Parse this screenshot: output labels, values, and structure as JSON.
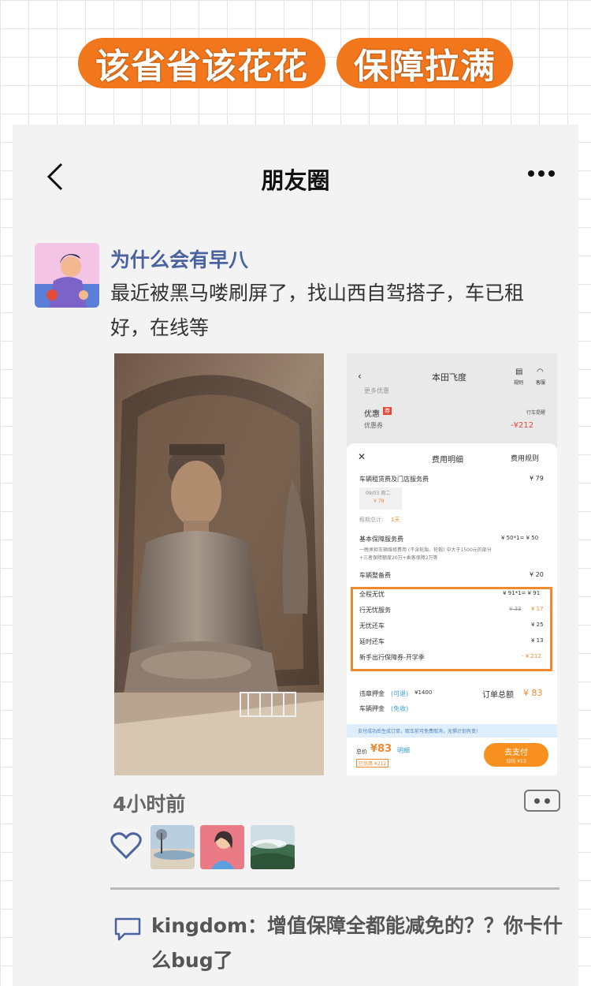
{
  "headline": {
    "left": "该省省该花花",
    "right": "保障拉满"
  },
  "nav": {
    "title": "朋友圈",
    "back_icon": "chevron-left-icon",
    "more_icon": "more-dots-icon"
  },
  "post": {
    "username": "为什么会有早八",
    "text": "最近被黑马喽刷屏了，找山西自驾搭子，车已租好，在线等",
    "time": "4小时前"
  },
  "receipt": {
    "car_name": "本田飞度",
    "rule_label": "规则",
    "service_label": "客服",
    "promo_label": "更多优惠",
    "discount_label": "优惠",
    "discount_tag": "券",
    "coupon_label": "优惠券",
    "coupon_value": "-¥212",
    "reminder_label": "行车提醒",
    "sheet_title": "费用明细",
    "sheet_rules": "费用规则",
    "rent_label": "车辆租赁费及门店服务费",
    "rent_value": "¥ 79",
    "date_chip": "09/03 周二",
    "date_price": "¥ 79",
    "total_days_label": "租期总计:",
    "total_days_value": "1天",
    "basic_label": "基本保障服务费",
    "basic_value": "¥ 50*1= ¥ 50",
    "basic_desc1": "一晚承担车辆维修费用 (不含轮胎、轮毂) 中大于1500元的部分",
    "basic_desc2": "+三者保障额度20万+乘客保障2万等",
    "prep_label": "车辆整备费",
    "prep_value": "¥ 20",
    "hl_items": [
      {
        "label": "全程无忧",
        "value": "¥ 91*1= ¥ 91",
        "strike": ""
      },
      {
        "label": "行无忧服务",
        "value": "¥ 17",
        "strike": "¥ 33"
      },
      {
        "label": "无忧还车",
        "value": "¥ 25",
        "strike": ""
      },
      {
        "label": "延时还车",
        "value": "¥ 13",
        "strike": ""
      },
      {
        "label": "新手出行保障券-开学季",
        "value": "- ¥ 212",
        "strike": ""
      }
    ],
    "deposit1_label": "违章押金",
    "deposit1_tag": "(可退)",
    "deposit1_value": "¥1400",
    "deposit2_label": "车辆押金",
    "deposit2_tag": "(免收)",
    "order_total_label": "订单总额",
    "order_total_value": "¥ 83",
    "notice": "支付成功后生成订单，取车前可免费取消，无惧计划有变!",
    "total_label": "总价",
    "total_value": "¥83",
    "detail_link": "明细",
    "saved_tag": "已优惠 ¥212",
    "pay_button": "去支付",
    "pay_sub": "日均 ¥13"
  },
  "comment": {
    "author": "kingdom",
    "text": "增值保障全都能减免的？？你卡什么bug了"
  },
  "colors": {
    "accent": "#f2761c",
    "link": "#4a62a0",
    "highlight_border": "#f08a30"
  }
}
